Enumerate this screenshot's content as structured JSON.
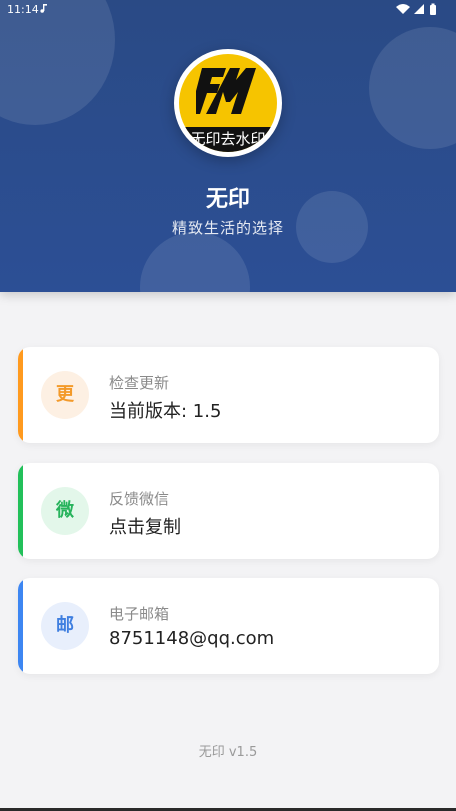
{
  "status_bar": {
    "time": "11:14"
  },
  "header": {
    "logo_text": "无印去水印",
    "app_name": "无印",
    "slogan": "精致生活的选择"
  },
  "cards": [
    {
      "icon": "更",
      "label": "检查更新",
      "value": "当前版本: 1.5",
      "accent": "#ff9a1f",
      "icon_bg": "#fdf0e3",
      "icon_color": "#f39a2a"
    },
    {
      "icon": "微",
      "label": "反馈微信",
      "value": "点击复制",
      "accent": "#22c05a",
      "icon_bg": "#e3f7ea",
      "icon_color": "#27b35c"
    },
    {
      "icon": "邮",
      "label": "电子邮箱",
      "value": "8751148@qq.com",
      "accent": "#3d86f2",
      "icon_bg": "#e8effc",
      "icon_color": "#3f7fe0"
    }
  ],
  "footer": {
    "version_text": "无印 v1.5"
  },
  "icons": {
    "status_notification": "music-note-icon",
    "status_wifi": "wifi-icon",
    "status_signal": "signal-icon",
    "status_battery": "battery-icon"
  }
}
